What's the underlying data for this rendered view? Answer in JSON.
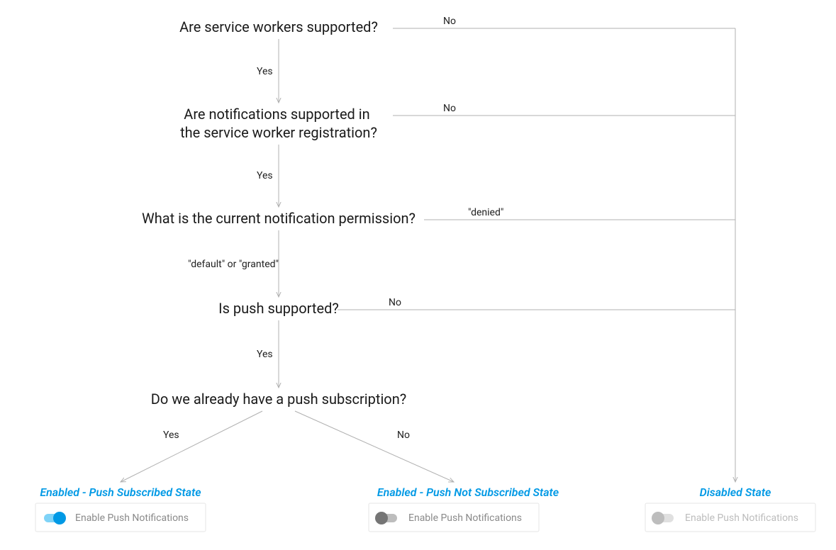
{
  "flow": {
    "q1": "Are service workers supported?",
    "q2a": "Are notifications supported in",
    "q2b": "the service worker registration?",
    "q3": "What is the current notification permission?",
    "q4": "Is push supported?",
    "q5": "Do we already have a push subscription?"
  },
  "edges": {
    "yes": "Yes",
    "no": "No",
    "denied": "\"denied\"",
    "default_or_granted": "\"default\" or \"granted\""
  },
  "states": {
    "subscribed": "Enabled - Push Subscribed State",
    "not_subscribed": "Enabled - Push Not Subscribed State",
    "disabled": "Disabled State"
  },
  "toggle_label": "Enable Push Notifications",
  "colors": {
    "accent": "#0099e5",
    "grey_track": "#bdbdbd",
    "grey_knob": "#757575",
    "disabled_track": "#e0e0e0",
    "disabled_knob": "#bdbdbd",
    "line": "#b0b0b0"
  }
}
